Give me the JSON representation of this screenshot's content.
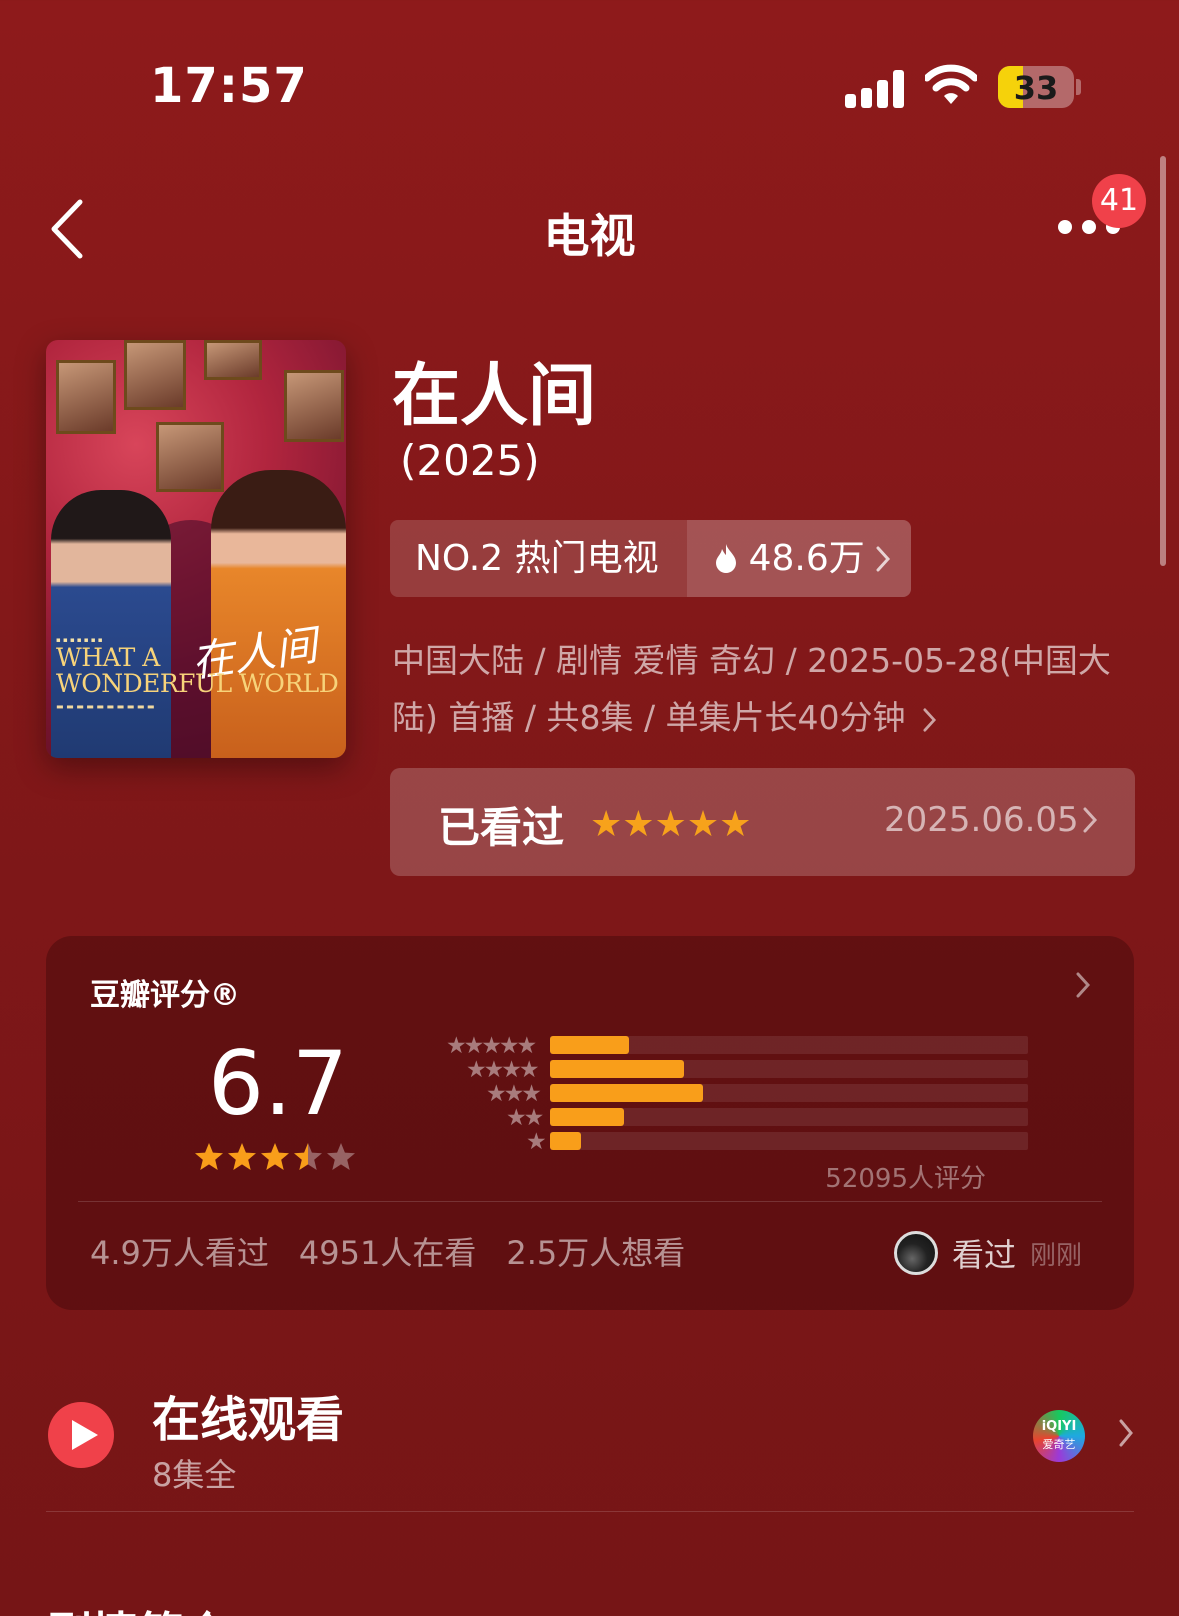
{
  "status_bar": {
    "time": "17:57",
    "battery": "33"
  },
  "nav": {
    "title": "电视",
    "badge": "41"
  },
  "poster": {
    "en_line1": "WHAT A",
    "en_line2": "WONDERFUL WORLD",
    "cn_title": "在人间"
  },
  "show": {
    "title": "在人间",
    "year": "(2025)",
    "rank_label": "NO.2 热门电视",
    "heat": "48.6万",
    "meta": "中国大陆 / 剧情 爱情 奇幻 / 2025-05-28(中国大陆) 首播 / 共8集 / 单集片长40分钟"
  },
  "watched": {
    "label": "已看过",
    "stars": "★★★★★",
    "date": "2025.06.05"
  },
  "rating": {
    "title": "豆瓣评分®",
    "score": "6.7",
    "count": "52095人评分",
    "stats": [
      "4.9万人看过",
      "4951人在看",
      "2.5万人想看"
    ],
    "me_label": "看过",
    "me_time": "刚刚"
  },
  "chart_data": {
    "type": "bar",
    "categories": [
      "★★★★★",
      "★★★★",
      "★★★",
      "★★",
      "★"
    ],
    "values": [
      16.5,
      28,
      32,
      15.5,
      6.5
    ],
    "ylim": [
      0,
      100
    ],
    "stars_filled": 3.5
  },
  "online": {
    "title": "在线观看",
    "sub": "8集全",
    "provider_top": "iQIYI",
    "provider_bottom": "爱奇艺"
  },
  "next_section": {
    "title": "剧情简介"
  },
  "colors": {
    "accent": "#f99e1a",
    "badge": "#f0414a",
    "background": "#8e1a1b"
  }
}
